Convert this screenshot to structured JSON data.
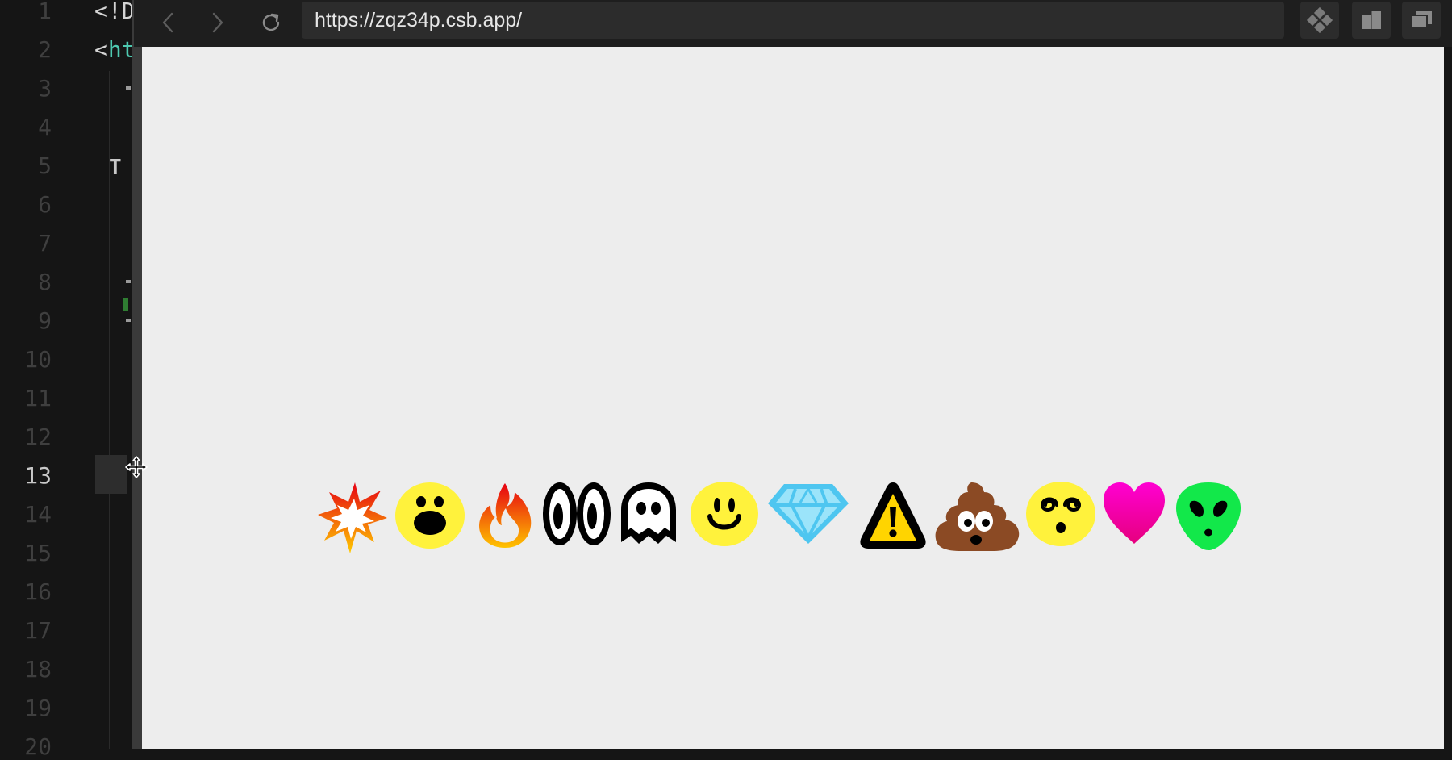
{
  "editor": {
    "line_numbers": [
      "1",
      "2",
      "3",
      "4",
      "5",
      "6",
      "7",
      "8",
      "9",
      "10",
      "11",
      "12",
      "13",
      "14",
      "15",
      "16",
      "17",
      "18",
      "19",
      "20"
    ],
    "active_line": "13",
    "code_fragments": {
      "line1": "<!D",
      "line2_punct": "<",
      "line2_tag": "ht",
      "line5": "T"
    }
  },
  "browser": {
    "url": "https://zqz34p.csb.app/",
    "nav": {
      "back_icon": "chevron-left-icon",
      "forward_icon": "chevron-right-icon",
      "reload_icon": "reload-icon"
    },
    "tools": [
      "devtools-diamond-icon",
      "split-view-icon",
      "new-window-icon"
    ]
  },
  "preview": {
    "emojis": [
      "explosion",
      "shocked-face",
      "fire",
      "eyes",
      "ghost",
      "smiley-face",
      "diamond",
      "warning",
      "poop",
      "dizzy-face",
      "heart",
      "alien"
    ]
  },
  "colors": {
    "editor_bg": "#151515",
    "preview_bg": "#ededed",
    "url_bar_bg": "#2c2c2c",
    "yellow": "#fff23c",
    "magenta": "#f000b4",
    "green": "#12e84a",
    "cyan": "#4ec6f0",
    "brown": "#8b4a24"
  }
}
